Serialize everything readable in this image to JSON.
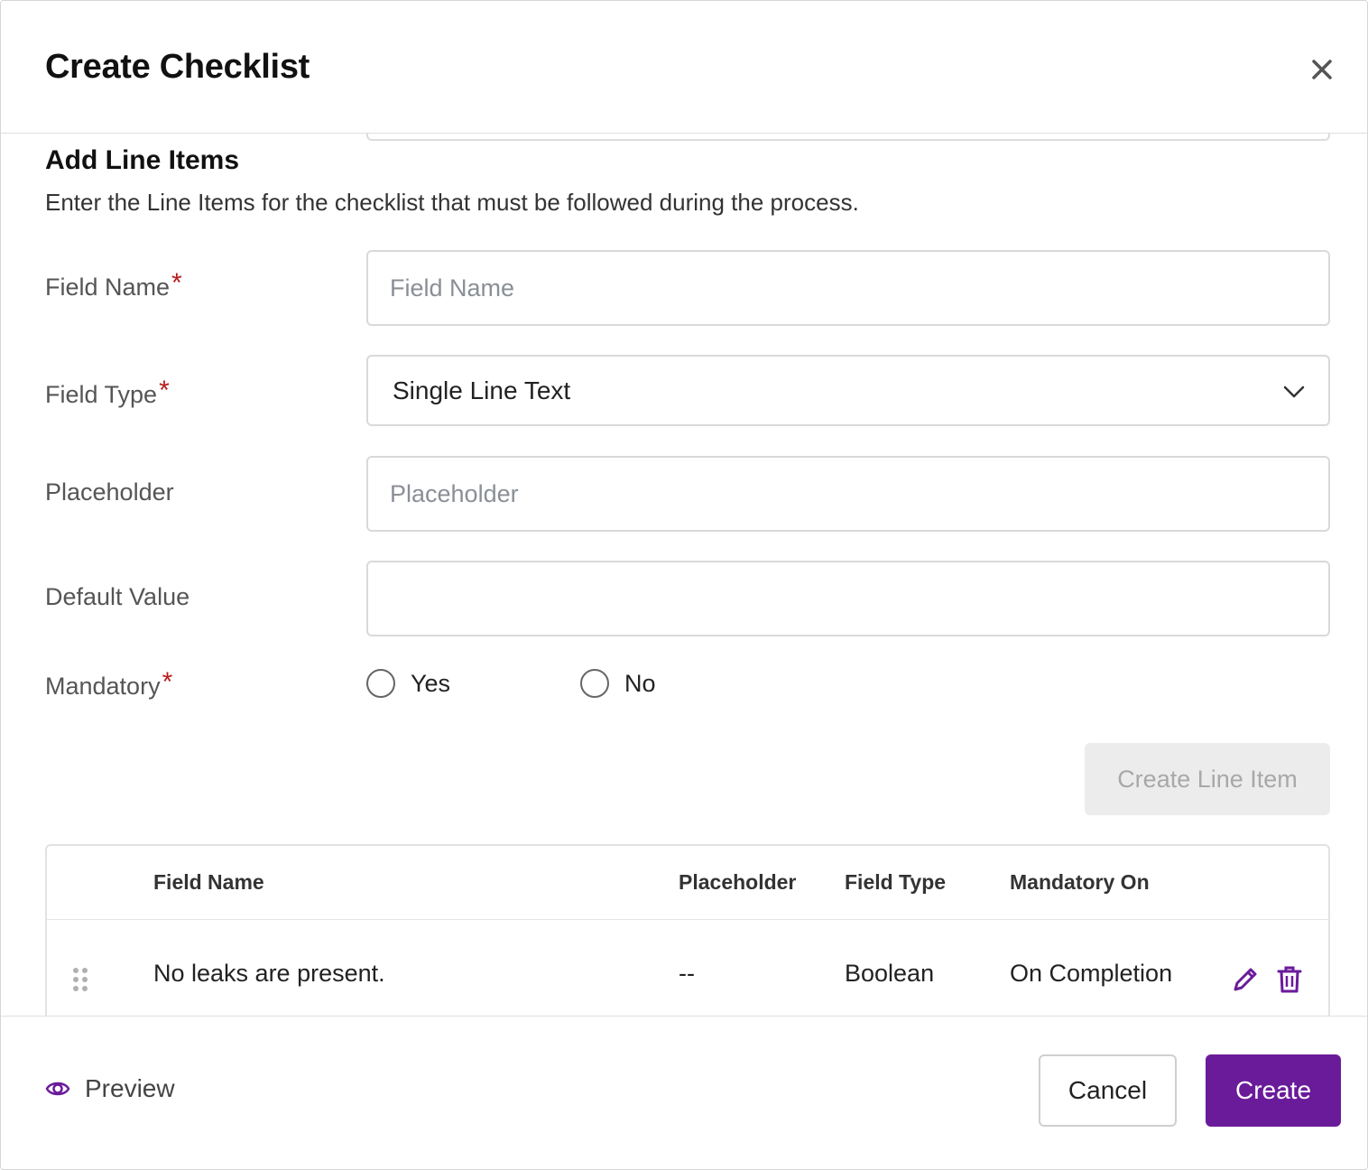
{
  "modal": {
    "title": "Create Checklist"
  },
  "section": {
    "title": "Add Line Items",
    "description": "Enter the Line Items for the checklist that must be followed during the process."
  },
  "form": {
    "field_name": {
      "label": "Field Name",
      "required_mark": "*",
      "placeholder": "Field Name",
      "value": ""
    },
    "field_type": {
      "label": "Field Type",
      "required_mark": "*",
      "value": "Single Line Text"
    },
    "placeholder": {
      "label": "Placeholder",
      "placeholder": "Placeholder",
      "value": ""
    },
    "default_value": {
      "label": "Default Value",
      "value": ""
    },
    "mandatory": {
      "label": "Mandatory",
      "required_mark": "*",
      "options": [
        "Yes",
        "No"
      ]
    },
    "create_line_item_label": "Create Line Item"
  },
  "table": {
    "headers": [
      "Field Name",
      "Placeholder",
      "Field Type",
      "Mandatory On"
    ],
    "rows": [
      {
        "field_name": "No leaks are present.",
        "placeholder": "--",
        "field_type": "Boolean",
        "mandatory_on": "On Completion"
      }
    ]
  },
  "footer": {
    "preview_label": "Preview",
    "cancel_label": "Cancel",
    "create_label": "Create"
  },
  "colors": {
    "accent": "#6a1b9a",
    "required": "#b71c1c",
    "disabled_bg": "#ececec"
  },
  "icons": [
    "close-icon",
    "chevron-down-icon",
    "drag-handle-icon",
    "pencil-icon",
    "trash-icon",
    "eye-icon"
  ]
}
